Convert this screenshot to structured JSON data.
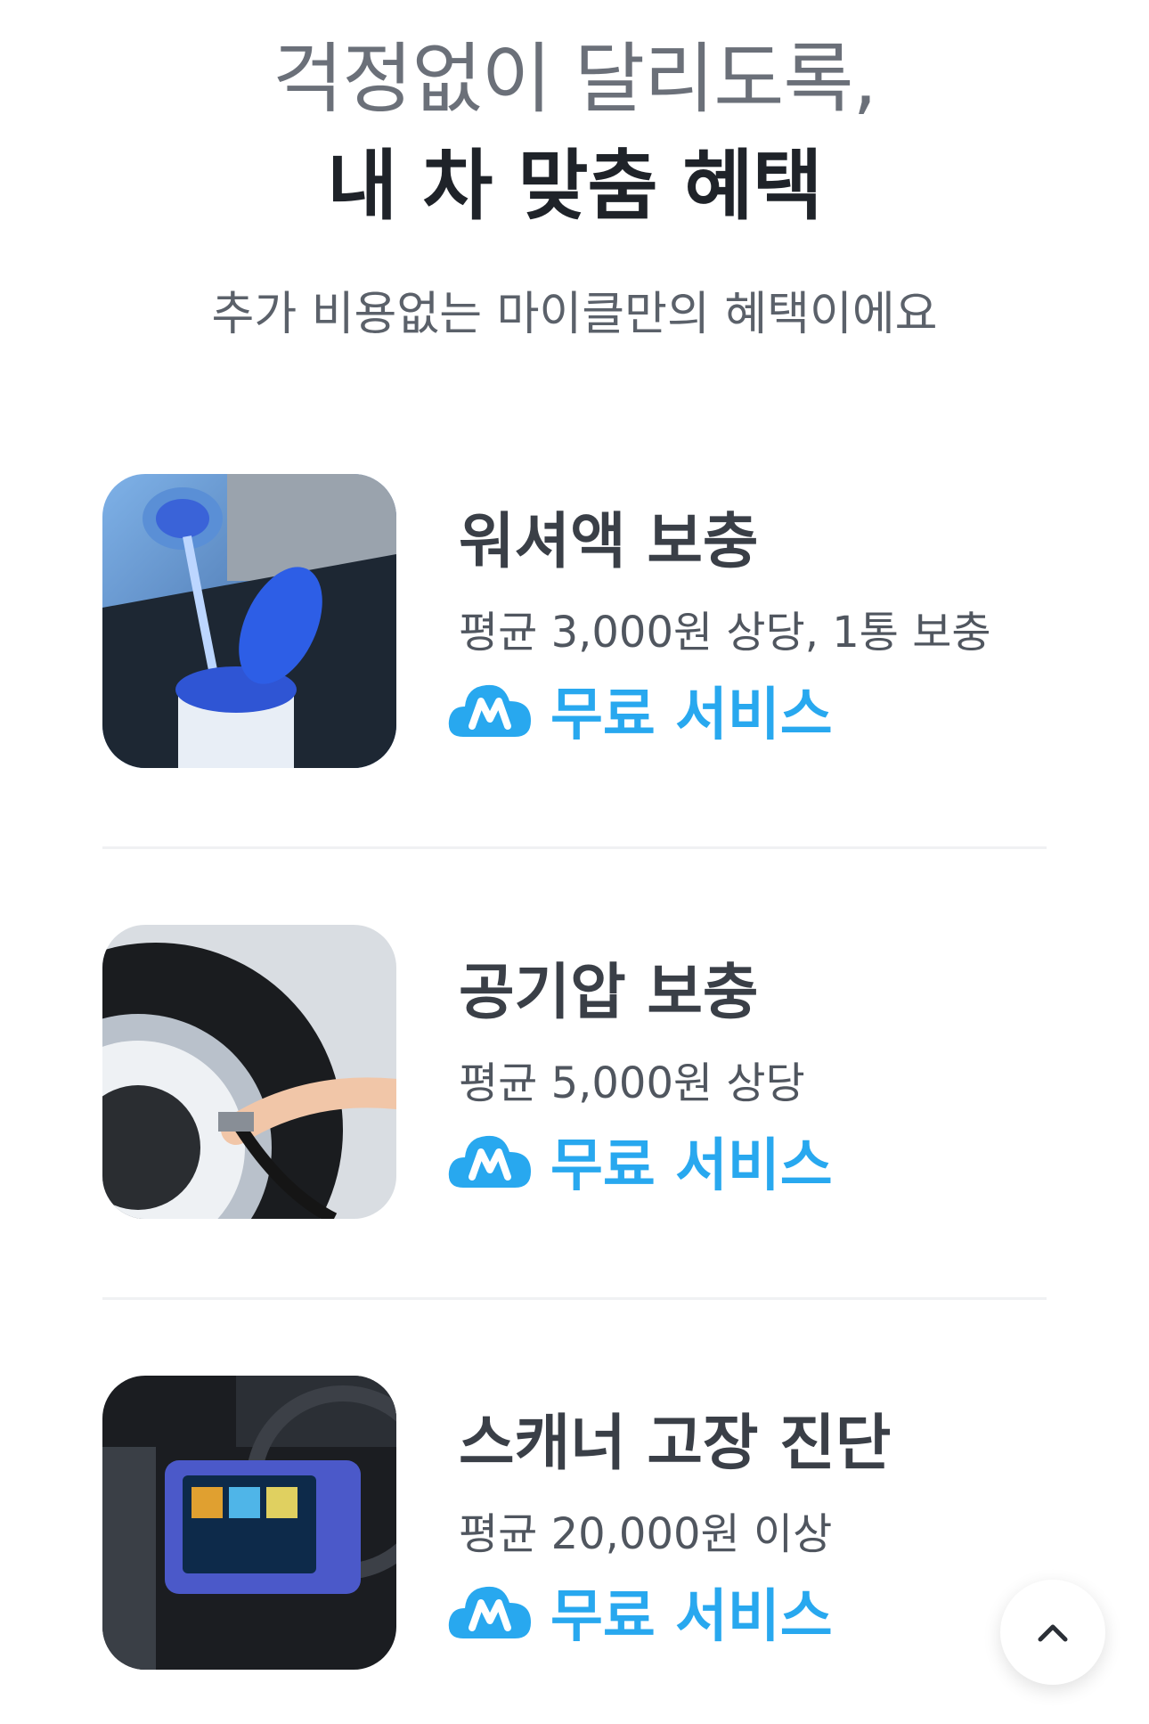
{
  "hero": {
    "line1": "걱정없이 달리도록,",
    "line2": "내 차 맞춤 혜택",
    "subtitle": "추가 비용없는 마이클만의 혜택이에요"
  },
  "benefits": [
    {
      "title": "워셔액 보충",
      "desc": "평균 3,000원 상당, 1통 보충",
      "badge": "무료 서비스",
      "image": "washer-fluid-photo"
    },
    {
      "title": "공기압 보충",
      "desc": "평균 5,000원 상당",
      "badge": "무료 서비스",
      "image": "tire-pressure-photo"
    },
    {
      "title": "스캐너 고장 진단",
      "desc": "평균 20,000원 이상",
      "badge": "무료 서비스",
      "image": "diagnostic-scanner-photo"
    }
  ],
  "colors": {
    "accent": "#28a8ef",
    "title": "#3a3f47",
    "muted": "#6b7079"
  },
  "icons": {
    "badge": "m-cloud-icon",
    "scroll": "chevron-up-icon"
  }
}
